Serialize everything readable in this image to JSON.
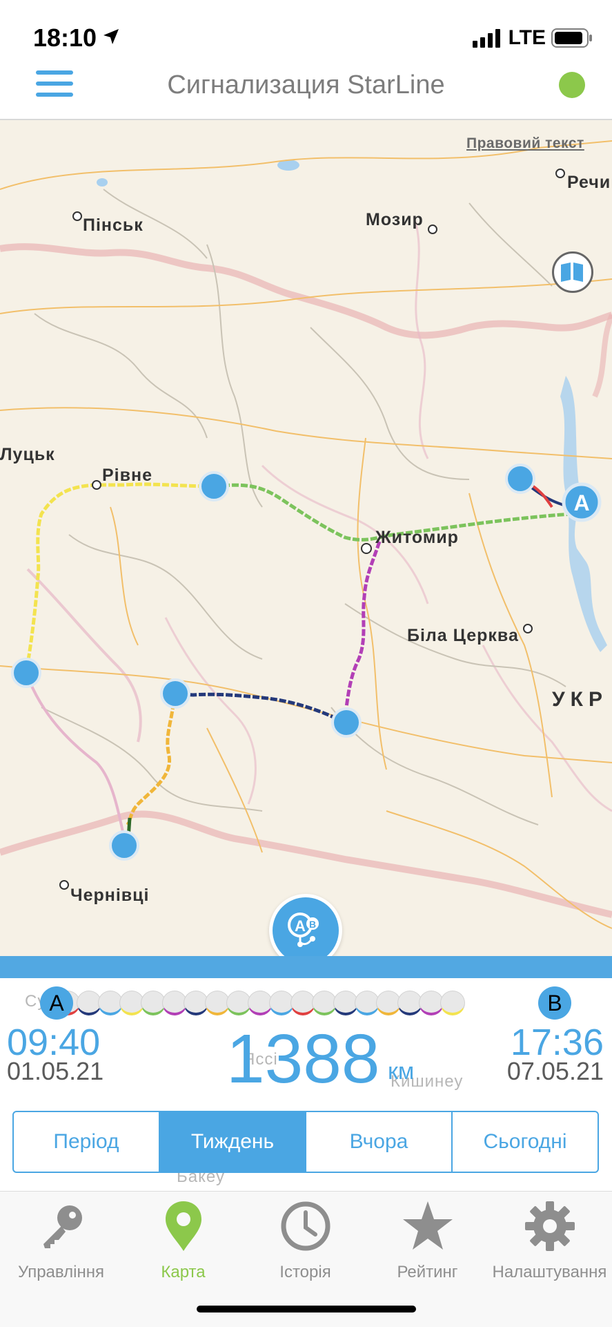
{
  "status_bar": {
    "time": "18:10",
    "network": "LTE"
  },
  "header": {
    "title": "Сигнализация StarLine"
  },
  "map": {
    "legal_link": "Правовий текст",
    "cities": [
      "Пінськ",
      "Мозир",
      "Речиц",
      "Луцьк",
      "Рівне",
      "Житомир",
      "Біла Церква",
      "Чернівці"
    ],
    "country": "УКР",
    "faded_labels": [
      "Су",
      "Яссі",
      "Кишинеу",
      "Бакеу"
    ],
    "colors": {
      "yellow": "#f3e34f",
      "green": "#7cc35c",
      "purple": "#b23fb6",
      "navy": "#24397a",
      "orange": "#f0b63a",
      "red": "#e04040",
      "marker": "#4aa6e3"
    }
  },
  "trip": {
    "start_pin": "A",
    "end_pin": "B",
    "start_time": "09:40",
    "start_date": "01.05.21",
    "end_time": "17:36",
    "end_date": "07.05.21",
    "distance": "1388",
    "distance_unit": "км",
    "segment_colors": [
      "#e04040",
      "#24397a",
      "#4aa6e3",
      "#f3e34f",
      "#7cc35c",
      "#b23fb6",
      "#24397a",
      "#f0b63a",
      "#7cc35c",
      "#b23fb6",
      "#4aa6e3",
      "#e04040",
      "#7cc35c",
      "#24397a",
      "#4aa6e3",
      "#f0b63a",
      "#24397a",
      "#b23fb6",
      "#f3e34f"
    ]
  },
  "periods": [
    {
      "label": "Період",
      "active": false
    },
    {
      "label": "Тиждень",
      "active": true
    },
    {
      "label": "Вчора",
      "active": false
    },
    {
      "label": "Сьогодні",
      "active": false
    }
  ],
  "tabs": [
    {
      "label": "Управління",
      "icon": "key-icon"
    },
    {
      "label": "Карта",
      "icon": "map-pin-icon",
      "active": true
    },
    {
      "label": "Історія",
      "icon": "clock-icon"
    },
    {
      "label": "Рейтинг",
      "icon": "star-icon"
    },
    {
      "label": "Налаштування",
      "icon": "gear-icon"
    }
  ]
}
